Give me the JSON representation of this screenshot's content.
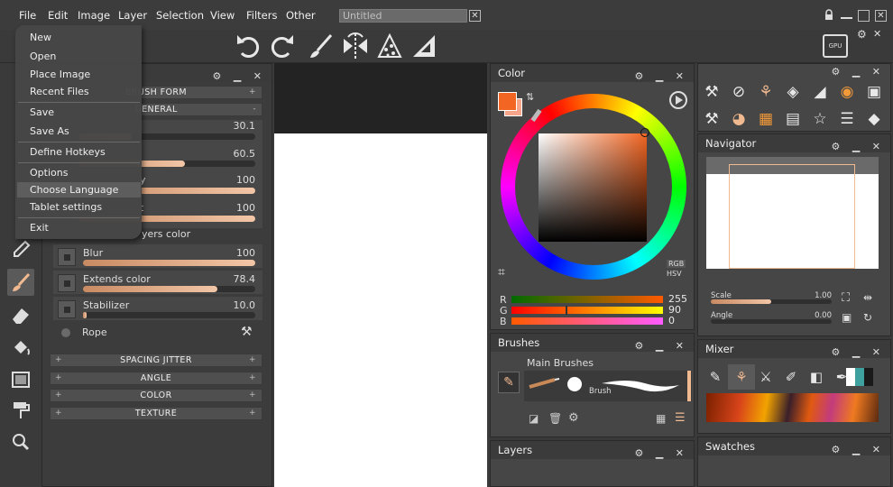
{
  "menubar": {
    "items": [
      "File",
      "Edit",
      "Image",
      "Layer",
      "Selection",
      "View",
      "Filters",
      "Other"
    ],
    "document_tab": "Untitled",
    "close_tab": "✕",
    "window_buttons": [
      "lock-icon",
      "minimize-icon",
      "maximize-icon",
      "close-icon"
    ]
  },
  "file_menu": {
    "items": [
      "New",
      "Open",
      "Place Image",
      "Recent Files",
      "Save",
      "Save As",
      "Define Hotkeys",
      "Options",
      "Choose Language",
      "Tablet settings",
      "Exit"
    ],
    "highlighted": "Choose Language"
  },
  "top_toolbar": {
    "icons": [
      "undo-icon",
      "redo-icon",
      "brush-icon",
      "symmetry-icon",
      "dots-icon",
      "ruler-icon"
    ],
    "gpu_label": "GPU"
  },
  "brush_panel": {
    "sections": [
      "BRUSH FORM",
      "GENERAL"
    ],
    "rows": [
      {
        "label": "",
        "value": "30.1",
        "fill": 0.3
      },
      {
        "label": "",
        "value": "60.5",
        "fill": 0.6
      },
      {
        "label": "y",
        "value": "100",
        "fill": 1.0
      },
      {
        "label": "t",
        "value": "100",
        "fill": 1.0
      }
    ],
    "layers_color_label": "yers color",
    "blur": {
      "label": "Blur",
      "value": "100",
      "fill": 1.0
    },
    "extends": {
      "label": "Extends color",
      "value": "78.4",
      "fill": 0.78
    },
    "stabilizer": {
      "label": "Stabilizer",
      "value": "10.0",
      "fill": 0.02
    },
    "rope_label": "Rope",
    "bottom_sections": [
      "SPACING JITTER",
      "ANGLE",
      "COLOR",
      "TEXTURE"
    ]
  },
  "color_panel": {
    "title": "Color",
    "primary_color": "#f26522",
    "secondary_color": "#f7a58a",
    "mode_rgb": "RGB",
    "mode_hsv": "HSV",
    "channels": [
      {
        "name": "R",
        "value": "255",
        "fill": 1.0
      },
      {
        "name": "G",
        "value": "90",
        "fill": 0.35
      },
      {
        "name": "B",
        "value": "0",
        "fill": 0.0
      }
    ]
  },
  "brushes_panel": {
    "title": "Brushes",
    "group": "Main Brushes",
    "brush_name": "Brush"
  },
  "layers_panel": {
    "title": "Layers"
  },
  "navigator_panel": {
    "title": "Navigator",
    "scale_label": "Scale",
    "scale_value": "1.00",
    "scale_fill": 0.5,
    "angle_label": "Angle",
    "angle_value": "0.00",
    "angle_fill": 0.0
  },
  "mixer_panel": {
    "title": "Mixer"
  },
  "swatches_panel": {
    "title": "Swatches"
  },
  "colors": {
    "accent": "#f26522",
    "panel_bg": "#464646",
    "menubar_bg": "#3c3c3c"
  }
}
